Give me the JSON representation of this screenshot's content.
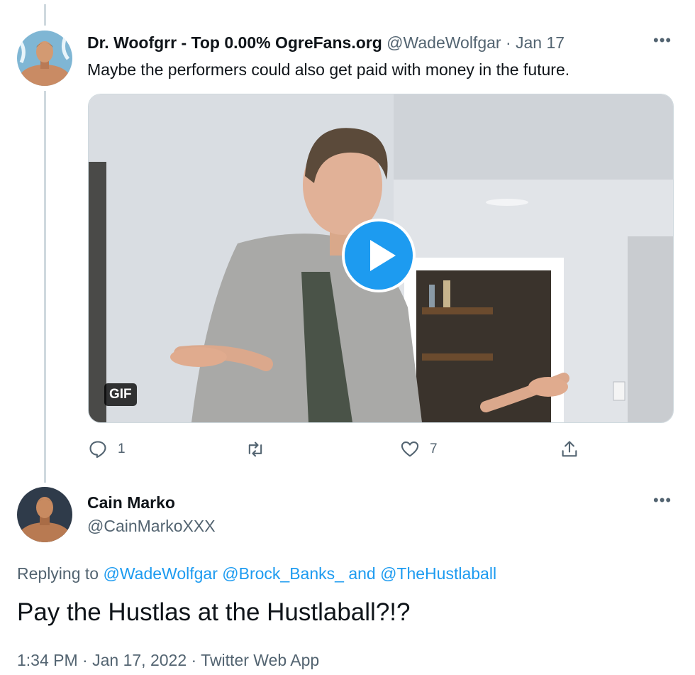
{
  "tweet1": {
    "display_name": "Dr. Woofgrr - Top 0.00% OgreFans.org",
    "handle": "@WadeWolfgar",
    "separator": "·",
    "date": "Jan 17",
    "text": "Maybe the performers could also get paid with money in the future.",
    "media_badge": "GIF",
    "actions": {
      "reply_count": "1",
      "retweet_count": "",
      "like_count": "7"
    }
  },
  "tweet2": {
    "display_name": "Cain Marko",
    "handle": "@CainMarkoXXX",
    "replying_prefix": "Replying to",
    "mention1": "@WadeWolfgar",
    "mention2": "@Brock_Banks_",
    "and_text": "and",
    "mention3": "@TheHustlaball",
    "text": "Pay the Hustlas at the Hustlaball?!?",
    "time": "1:34 PM",
    "sep1": "·",
    "date": "Jan 17, 2022",
    "sep2": "·",
    "source": "Twitter Web App"
  },
  "icons": {
    "more": "more-horizontal-icon",
    "reply": "reply-icon",
    "retweet": "retweet-icon",
    "like": "heart-icon",
    "share": "share-icon",
    "play": "play-icon"
  },
  "colors": {
    "accent": "#1d9bf0",
    "muted": "#536471",
    "text": "#0f1419"
  }
}
